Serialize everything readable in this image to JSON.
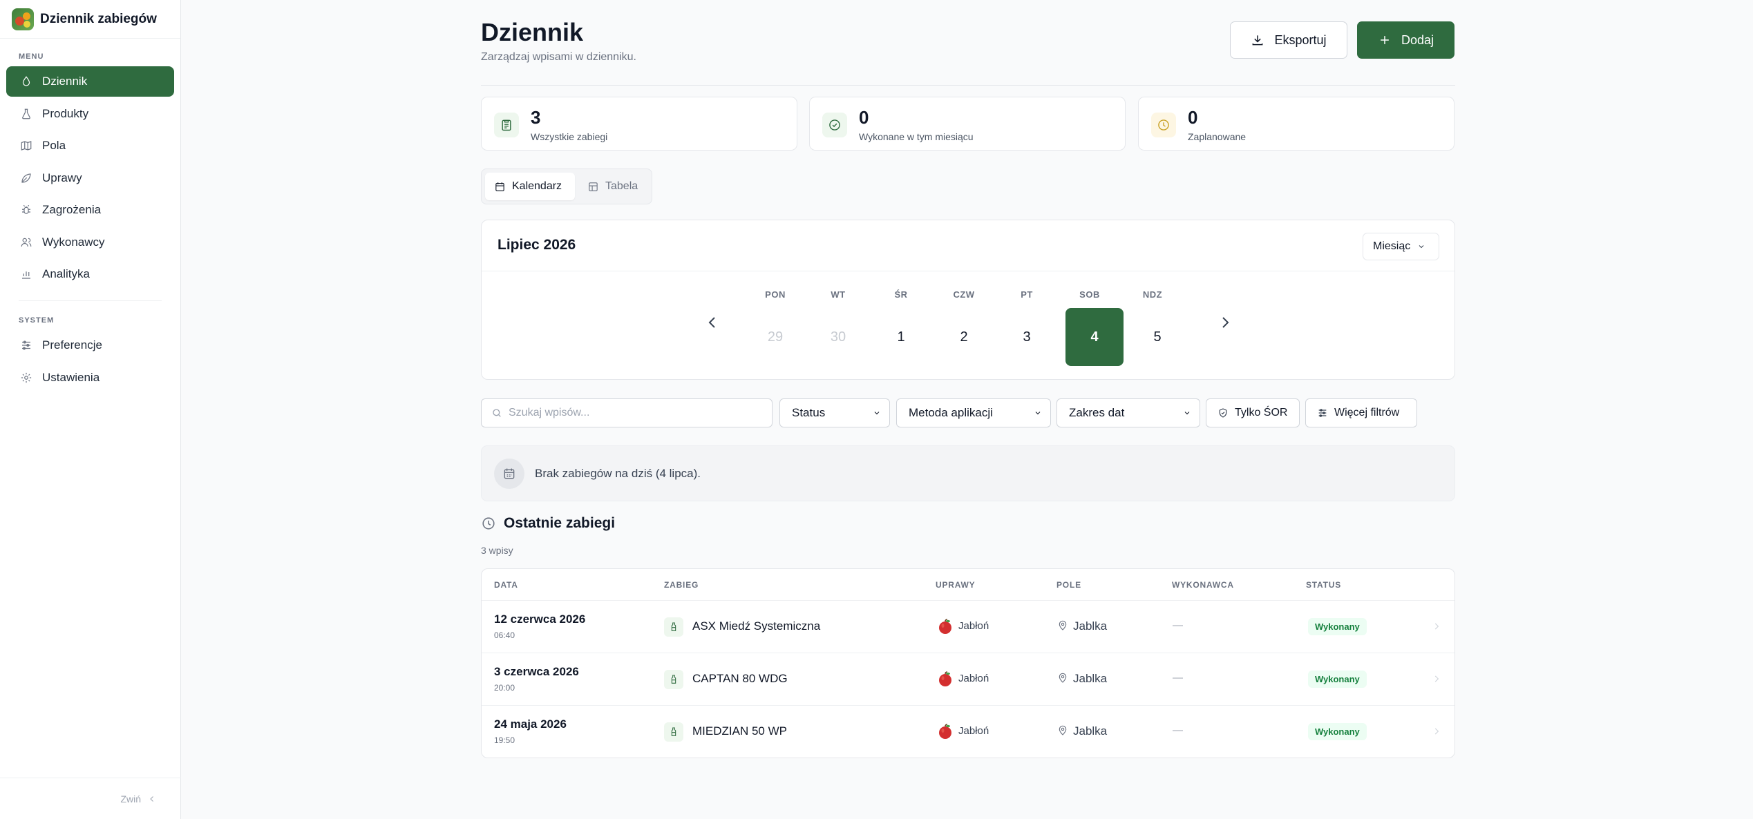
{
  "app": {
    "name": "Dziennik zabiegów"
  },
  "sidebar": {
    "menu_label": "MENU",
    "system_label": "SYSTEM",
    "menu_items": [
      {
        "label": "Dziennik",
        "icon": "droplet-icon",
        "active": true
      },
      {
        "label": "Produkty",
        "icon": "flask-icon"
      },
      {
        "label": "Pola",
        "icon": "map-icon"
      },
      {
        "label": "Uprawy",
        "icon": "leaf-icon"
      },
      {
        "label": "Zagrożenia",
        "icon": "bug-icon"
      },
      {
        "label": "Wykonawcy",
        "icon": "users-icon"
      },
      {
        "label": "Analityka",
        "icon": "bar-chart-icon"
      }
    ],
    "system_items": [
      {
        "label": "Preferencje",
        "icon": "sliders-icon"
      },
      {
        "label": "Ustawienia",
        "icon": "gear-icon"
      }
    ],
    "collapse_label": "Zwiń"
  },
  "header": {
    "title": "Dziennik",
    "subtitle": "Zarządzaj wpisami w dzienniku.",
    "export_label": "Eksportuj",
    "add_label": "Dodaj"
  },
  "stats": [
    {
      "value": "3",
      "label": "Wszystkie zabiegi",
      "icon": "clipboard-icon",
      "color": "#2f6b3f",
      "bg": "#eef7ee"
    },
    {
      "value": "0",
      "label": "Wykonane w tym miesiącu",
      "icon": "check-circle-icon",
      "color": "#2f6b3f",
      "bg": "#eef7ee"
    },
    {
      "value": "0",
      "label": "Zaplanowane",
      "icon": "clock-icon",
      "color": "#c9a227",
      "bg": "#fdf6e3"
    }
  ],
  "view_tabs": {
    "calendar": "Kalendarz",
    "table": "Tabela"
  },
  "calendar": {
    "title": "Lipiec 2026",
    "view_select": "Miesiąc",
    "weekdays": [
      "PON",
      "WT",
      "ŚR",
      "CZW",
      "PT",
      "SOB",
      "NDZ"
    ],
    "days": [
      {
        "label": "29",
        "muted": true
      },
      {
        "label": "30",
        "muted": true
      },
      {
        "label": "1"
      },
      {
        "label": "2"
      },
      {
        "label": "3"
      },
      {
        "label": "4",
        "selected": true
      },
      {
        "label": "5"
      }
    ]
  },
  "filters": {
    "search_placeholder": "Szukaj wpisów...",
    "status": "Status",
    "method": "Metoda aplikacji",
    "date_range": "Zakres dat",
    "sor_only": "Tylko ŚOR",
    "more_filters": "Więcej filtrów"
  },
  "empty_state": {
    "text": "Brak zabiegów na dziś (4 lipca)."
  },
  "recent": {
    "title": "Ostatnie zabiegi",
    "count": "3 wpisy",
    "columns": {
      "date": "DATA",
      "treatment": "ZABIEG",
      "crops": "UPRAWY",
      "field": "POLE",
      "executor": "WYKONAWCA",
      "status": "STATUS"
    },
    "rows": [
      {
        "date": "12 czerwca 2026",
        "time": "06:40",
        "product": "ASX Miedź Systemiczna",
        "crop": "Jabłoń",
        "field": "Jablka",
        "executor": "—",
        "status": "Wykonany"
      },
      {
        "date": "3 czerwca 2026",
        "time": "20:00",
        "product": "CAPTAN 80 WDG",
        "crop": "Jabłoń",
        "field": "Jablka",
        "executor": "—",
        "status": "Wykonany"
      },
      {
        "date": "24 maja 2026",
        "time": "19:50",
        "product": "MIEDZIAN 50 WP",
        "crop": "Jabłoń",
        "field": "Jablka",
        "executor": "—",
        "status": "Wykonany"
      }
    ]
  }
}
